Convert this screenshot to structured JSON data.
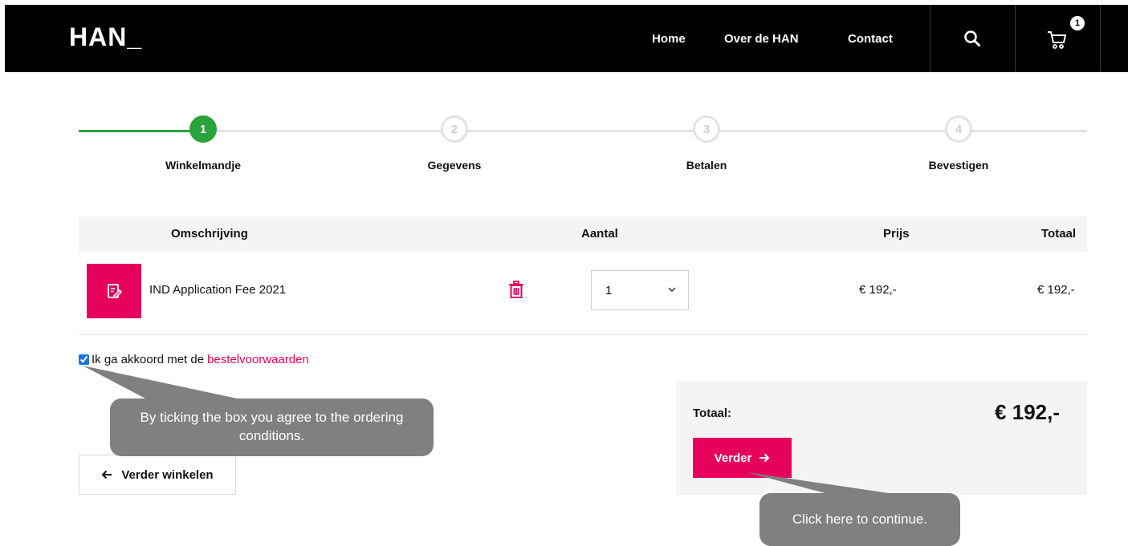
{
  "header": {
    "logo": "HAN_",
    "nav": {
      "home": "Home",
      "over": "Over de HAN",
      "contact": "Contact"
    },
    "cart_count": "1"
  },
  "steps": [
    {
      "number": "1",
      "label": "Winkelmandje",
      "state": "active"
    },
    {
      "number": "2",
      "label": "Gegevens",
      "state": "inactive"
    },
    {
      "number": "3",
      "label": "Betalen",
      "state": "inactive"
    },
    {
      "number": "4",
      "label": "Bevestigen",
      "state": "inactive"
    }
  ],
  "table": {
    "headers": {
      "description": "Omschrijving",
      "quantity": "Aantal",
      "price": "Prijs",
      "total": "Totaal"
    },
    "rows": [
      {
        "name": "IND Application Fee 2021",
        "quantity": "1",
        "price": "€ 192,-",
        "total": "€ 192,-"
      }
    ]
  },
  "agreement": {
    "checked": true,
    "text": "Ik ga akkoord met de",
    "link": "bestelvoorwaarden"
  },
  "summary": {
    "label": "Totaal:",
    "amount": "€ 192,-",
    "continue_label": "Verder"
  },
  "back_label": "Verder winkelen",
  "callouts": {
    "agree_hint": "By ticking the box you agree to the ordering conditions.",
    "continue_hint": "Click here to continue."
  },
  "colors": {
    "accent": "#e6005c",
    "step_active": "#2aa33c",
    "header_bg": "#000000",
    "callout_bg": "#808080"
  }
}
